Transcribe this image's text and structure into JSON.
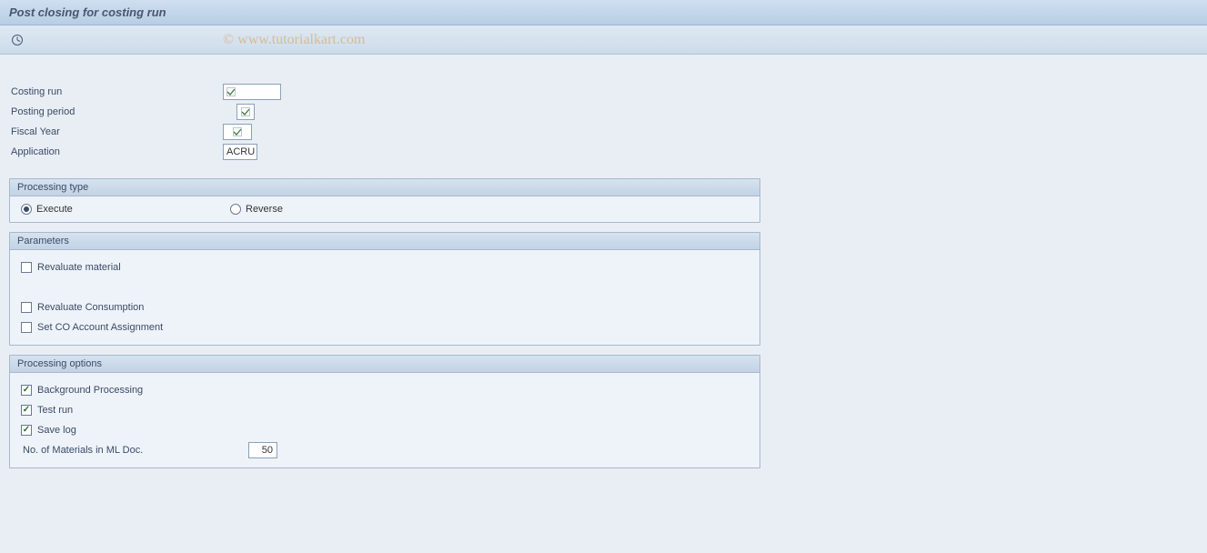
{
  "title": "Post closing for costing run",
  "watermark": "© www.tutorialkart.com",
  "fields": {
    "costing_run": {
      "label": "Costing run",
      "value": ""
    },
    "posting_period": {
      "label": "Posting period",
      "value": ""
    },
    "fiscal_year": {
      "label": "Fiscal Year",
      "value": ""
    },
    "application": {
      "label": "Application",
      "value": "ACRU"
    }
  },
  "processing_type": {
    "title": "Processing type",
    "options": {
      "execute": "Execute",
      "reverse": "Reverse"
    },
    "selected": "execute"
  },
  "parameters": {
    "title": "Parameters",
    "revaluate_material": {
      "label": "Revaluate material",
      "checked": false
    },
    "revaluate_consumption": {
      "label": "Revaluate Consumption",
      "checked": false
    },
    "set_co_assignment": {
      "label": "Set CO Account Assignment",
      "checked": false
    }
  },
  "processing_options": {
    "title": "Processing options",
    "background": {
      "label": "Background Processing",
      "checked": true
    },
    "test_run": {
      "label": "Test run",
      "checked": true
    },
    "save_log": {
      "label": "Save log",
      "checked": true
    },
    "num_materials": {
      "label": "No. of Materials in ML Doc.",
      "value": "50"
    }
  }
}
